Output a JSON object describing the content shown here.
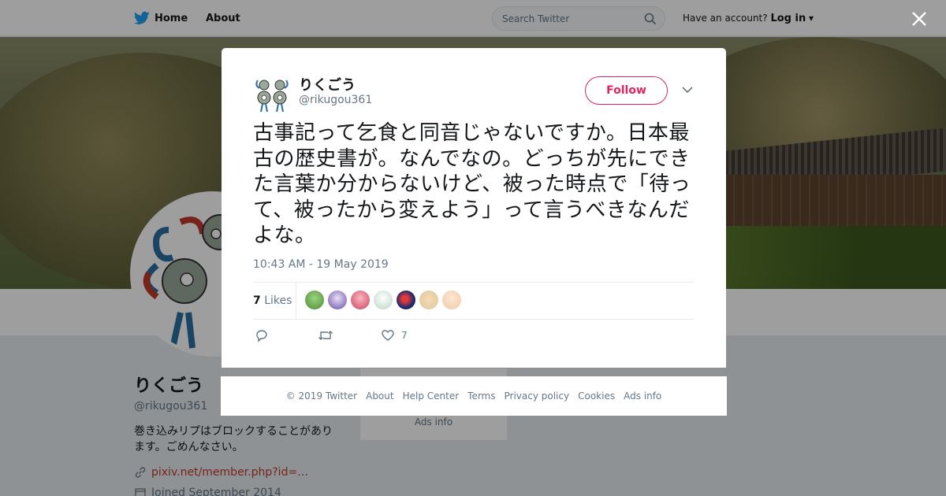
{
  "topbar": {
    "home_label": "Home",
    "about_label": "About",
    "search_placeholder": "Search Twitter",
    "have_account": "Have an account?",
    "login_label": "Log in"
  },
  "profile": {
    "name": "りくごう",
    "handle": "@rikugou361",
    "bio": "巻き込みリプはブロックすることがあります。ごめんなさい。",
    "link": "pixiv.net/member.php?id=…",
    "joined": "Joined September 2014"
  },
  "side_card": {
    "ads_label": "Ads info"
  },
  "tweet": {
    "author_name": "りくごう",
    "author_handle": "@rikugou361",
    "follow_label": "Follow",
    "text": "古事記って乞食と同音じゃないですか。日本最古の歴史書が。なんでなの。どっちが先にできた言葉か分からないけど、被った時点で「待って、被ったから変えよう」って言うべきなんだよな。",
    "timestamp": "10:43 AM - 19 May 2019",
    "likes_count": "7",
    "likes_label": "Likes",
    "like_action_count": "7"
  },
  "footer": {
    "copyright": "© 2019 Twitter",
    "links": [
      "About",
      "Help Center",
      "Terms",
      "Privacy policy",
      "Cookies",
      "Ads info"
    ]
  },
  "colors": {
    "accent": "#1da1f2",
    "follow": "#e0245e",
    "link": "#c0392b"
  }
}
